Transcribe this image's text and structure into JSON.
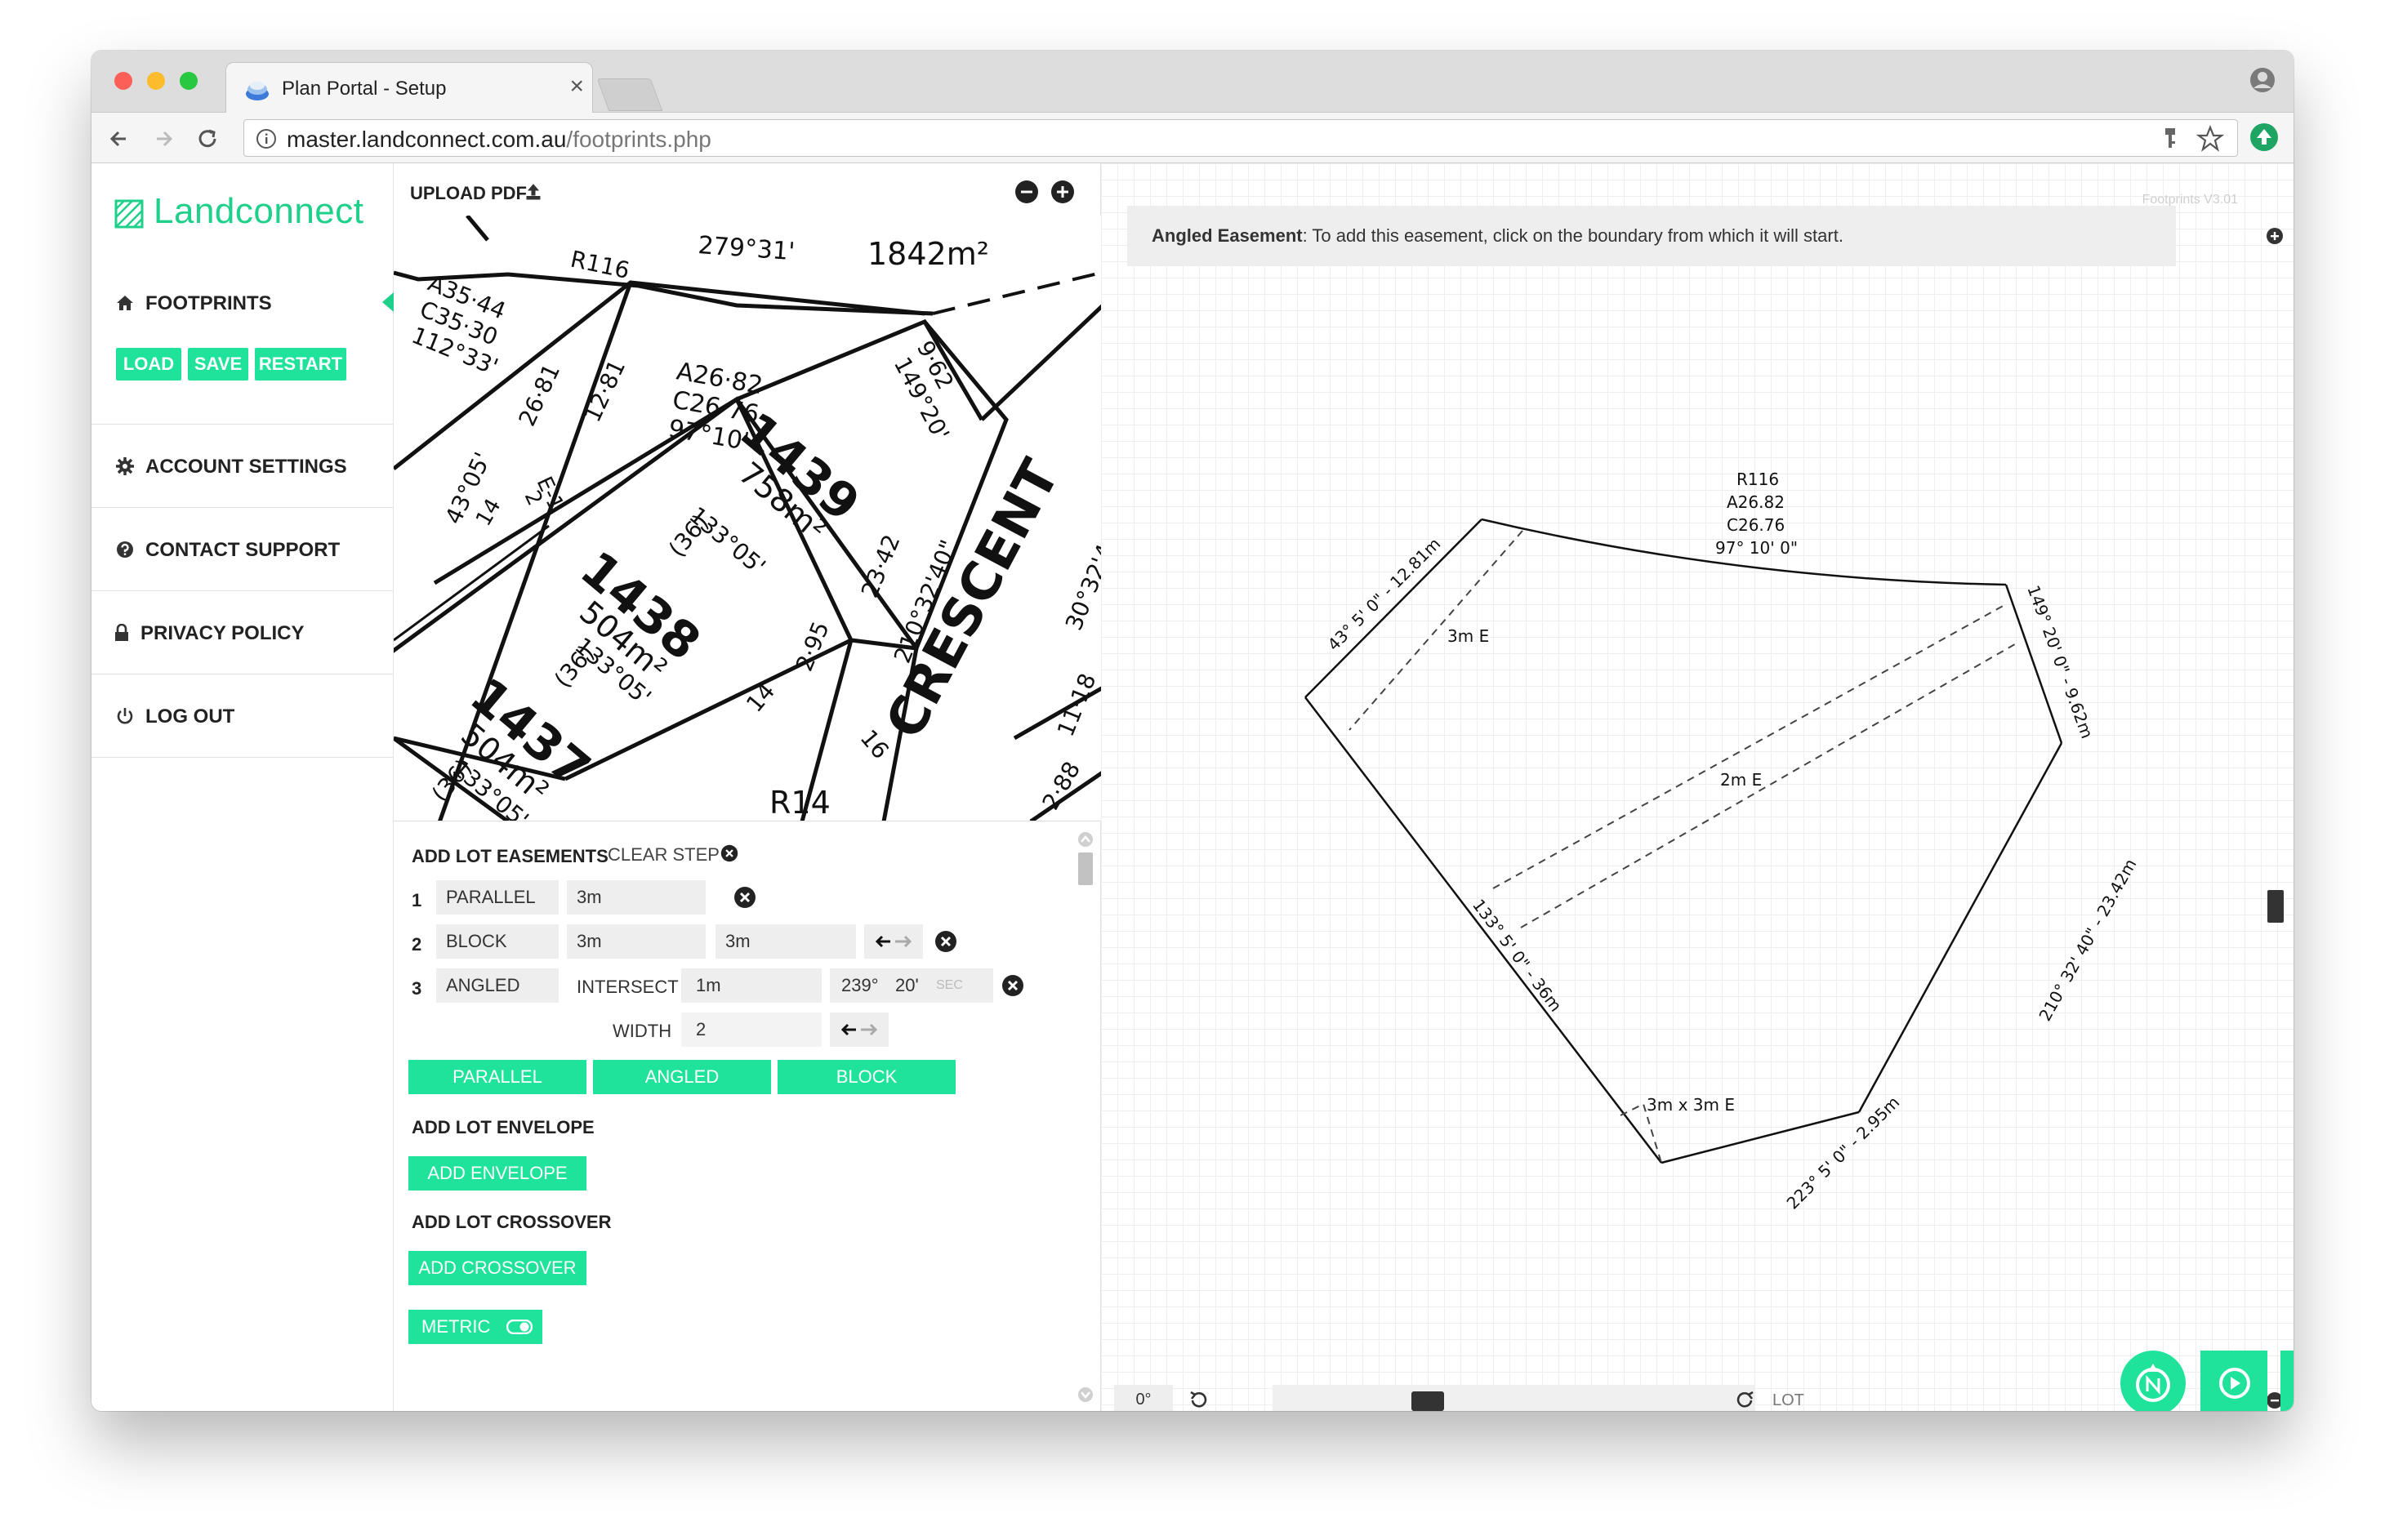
{
  "browser": {
    "tab_title": "Plan Portal - Setup",
    "url_host": "master.landconnect.com.au",
    "url_path": "/footprints.php"
  },
  "brand": {
    "name": "Landconnect",
    "accent_color": "#1fe39a"
  },
  "sidebar": {
    "footprints": "FOOTPRINTS",
    "buttons": [
      "LOAD",
      "SAVE",
      "RESTART"
    ],
    "account_settings": "ACCOUNT SETTINGS",
    "contact_support": "CONTACT SUPPORT",
    "privacy_policy": "PRIVACY POLICY",
    "log_out": "LOG OUT"
  },
  "pdf": {
    "upload_label": "UPLOAD PDF",
    "plan_text": {
      "lot1439": "1439",
      "area1439": "758m²",
      "lot1438": "1438",
      "area1438": "504m²",
      "lot1437": "1437",
      "area1437": "504m²",
      "crescent": "CRESCENT",
      "area_top": "1842m²",
      "bearing_top": "279°31'",
      "r116": "R116",
      "r14": "R14",
      "a3544": "A35·44",
      "c3530": "C35·30",
      "b11233": "112°33'",
      "a2682": "A26·82",
      "c2676": "C26·76",
      "b9710": "97°10'",
      "d2681": "26·81",
      "d1281": "12·81",
      "b4305": "43°05'",
      "b13305a": "133°05'",
      "b13305b": "133°05'",
      "b13305c": "133°05'",
      "d962": "9·62",
      "b14920": "149°20'",
      "d2342": "23·42",
      "b21032": "210°32'40\"",
      "d295": "2·95",
      "d288": "2·88",
      "d1118": "11·18",
      "b3032": "30°32'4",
      "n14": "14",
      "n16": "16",
      "n36a": "(36)",
      "n36b": "(36)",
      "n36c": "(36)",
      "e1": "E-1",
      "n2": "2",
      "n14b": "14"
    }
  },
  "easements": {
    "title": "ADD LOT EASEMENTS",
    "clear_step": "CLEAR STEP",
    "rows": [
      {
        "num": "1",
        "type": "PARALLEL",
        "v1": "3m"
      },
      {
        "num": "2",
        "type": "BLOCK",
        "v1": "3m",
        "v2": "3m"
      },
      {
        "num": "3",
        "type": "ANGLED",
        "intersect_label": "INTERSECT",
        "intersect": "1m",
        "deg": "239°",
        "min": "20'",
        "sec": "SEC",
        "width_label": "WIDTH",
        "width": "2"
      }
    ],
    "add_buttons": [
      "PARALLEL",
      "ANGLED",
      "BLOCK"
    ]
  },
  "envelope": {
    "title": "ADD LOT ENVELOPE",
    "button": "ADD ENVELOPE"
  },
  "crossover": {
    "title": "ADD LOT CROSSOVER",
    "button": "ADD CROSSOVER"
  },
  "metric": {
    "label": "METRIC"
  },
  "canvas": {
    "info_bold": "Angled Easement",
    "info_text": ": To add this easement, click on the boundary from which it will start.",
    "version": "Footprints V3.01",
    "labels": {
      "r116": "R116",
      "a2682": "A26.82",
      "c2676": "C26.76",
      "b9710": "97° 10' 0\"",
      "left_top": "43° 5' 0\" - 12.81m",
      "right_top": "149° 20' 0\" - 9.62m",
      "left_bottom": "133° 5' 0\" - 36m",
      "right_bottom": "210° 32' 40\" - 23.42m",
      "bottom": "223° 5' 0\" - 2.95m",
      "e3m": "3m E",
      "e2m": "2m E",
      "e3x3": "3m x 3m E"
    },
    "rotation": "0°",
    "lot_label": "LOT"
  }
}
